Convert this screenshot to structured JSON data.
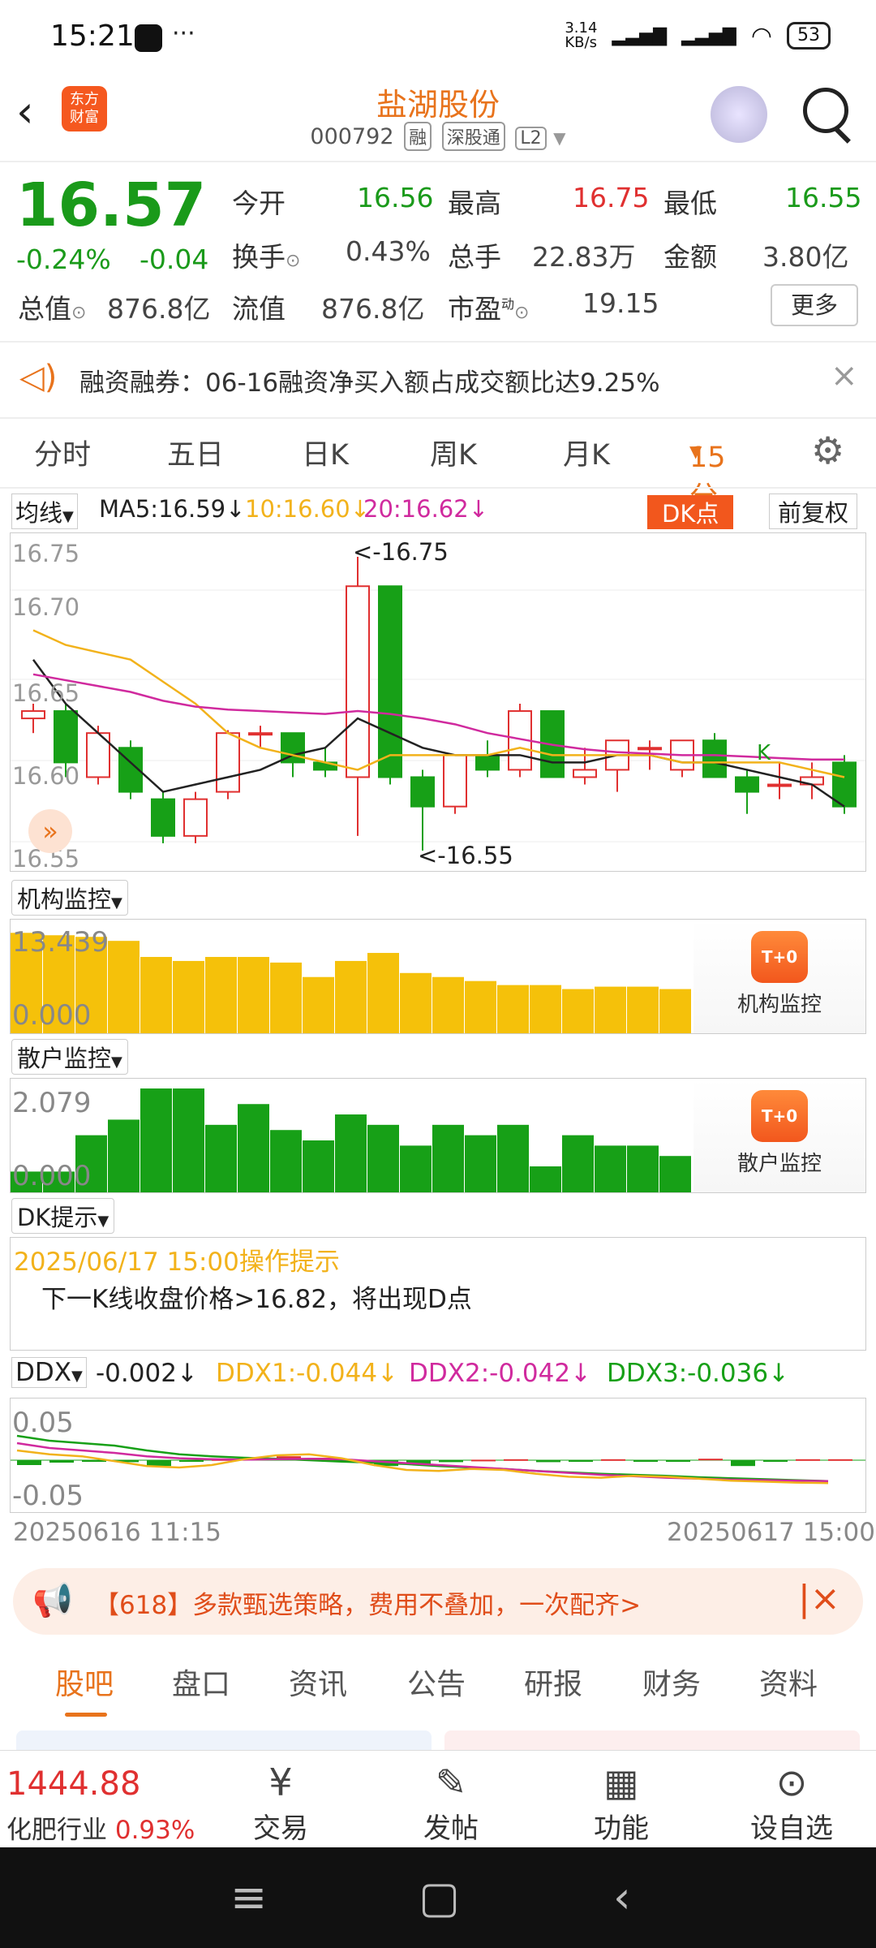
{
  "status": {
    "time": "15:21",
    "speed": "3.14\nKB/s",
    "battery": "53"
  },
  "header": {
    "logo": "东方\n财富",
    "title": "盐湖股份",
    "code": "000792",
    "tags": [
      "融",
      "深股通",
      "L2"
    ]
  },
  "quote": {
    "price": "16.57",
    "change_pct": "-0.24%",
    "change": "-0.04",
    "open_label": "今开",
    "open": "16.56",
    "high_label": "最高",
    "high": "16.75",
    "low_label": "最低",
    "low": "16.55",
    "turnover_label": "换手",
    "turnover": "0.43%",
    "volume_label": "总手",
    "volume": "22.83万",
    "amount_label": "金额",
    "amount": "3.80亿",
    "mktcap_label": "总值",
    "mktcap": "876.8亿",
    "float_label": "流值",
    "float": "876.8亿",
    "pe_label": "市盈",
    "pe_sup": "动",
    "pe": "19.15",
    "more": "更多"
  },
  "notice": {
    "text": "融资融券：06-16融资净买入额占成交额比达9.25%"
  },
  "ktabs": [
    "分时",
    "五日",
    "日K",
    "周K",
    "月K",
    "15分"
  ],
  "ma": {
    "selector": "均线",
    "ma5": "MA5:16.59",
    "ma10": "10:16.60",
    "ma20": "20:16.62",
    "dk": "DK点",
    "fuquan": "前复权"
  },
  "kchart": {
    "y_labels": [
      "16.75",
      "16.70",
      "16.65",
      "16.60",
      "16.55"
    ],
    "max_label": "<-16.75",
    "min_label": "<-16.55",
    "k_mark": "K"
  },
  "inst": {
    "selector": "机构监控",
    "max": "13.439",
    "min": "0.000",
    "card": "机构监控",
    "badge": "T+0",
    "values": [
      12.5,
      12.2,
      12.0,
      11.5,
      9.5,
      9.0,
      9.5,
      9.5,
      8.8,
      7.0,
      9.0,
      10.0,
      7.5,
      7.0,
      6.5,
      6.0,
      6.0,
      5.5,
      5.8,
      5.8,
      5.5
    ]
  },
  "retail": {
    "selector": "散户监控",
    "max": "2.079",
    "min": "0.000",
    "card": "散户监控",
    "badge": "T+0",
    "values": [
      0.4,
      0.4,
      1.1,
      1.4,
      2.0,
      2.0,
      1.3,
      1.7,
      1.2,
      1.0,
      1.5,
      1.3,
      0.9,
      1.3,
      1.1,
      1.3,
      0.5,
      1.1,
      0.9,
      0.9,
      0.7
    ]
  },
  "dk": {
    "selector": "DK提示",
    "date": "2025/06/17 15:00操作提示",
    "text": "下一K线收盘价格>16.82，将出现D点"
  },
  "ddx": {
    "selector": "DDX",
    "ddx": "-0.002",
    "ddx1": "DDX1:-0.044",
    "ddx2": "DDX2:-0.042",
    "ddx3": "DDX3:-0.036",
    "ymax": "0.05",
    "ymin": "-0.05",
    "start": "20250616 11:15",
    "end": "20250617 15:00"
  },
  "promo": {
    "text": "【618】多款甄选策略，费用不叠加，一次配齐>"
  },
  "btabs": [
    "股吧",
    "盘口",
    "资讯",
    "公告",
    "研报",
    "财务",
    "资料"
  ],
  "nav": {
    "index": "1444.88",
    "sector": "化肥行业",
    "sector_pct": "0.93%",
    "items": [
      "交易",
      "发帖",
      "功能",
      "设自选"
    ]
  },
  "colors": {
    "accent": "#e8731c",
    "up": "#e03030",
    "down": "#1a9a1a",
    "ma10": "#f2b21b",
    "ma20": "#d02a9e",
    "inst": "#f5c10a",
    "retail": "#17a017"
  }
}
